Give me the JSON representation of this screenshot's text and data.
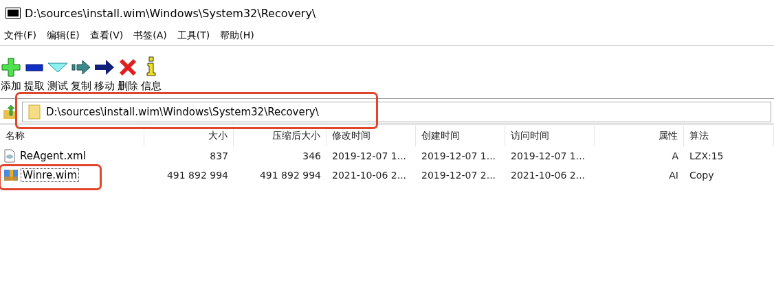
{
  "window": {
    "title": "D:\\sources\\install.wim\\Windows\\System32\\Recovery\\"
  },
  "menu": [
    "文件(F)",
    "编辑(E)",
    "查看(V)",
    "书签(A)",
    "工具(T)",
    "帮助(H)"
  ],
  "toolbar": [
    {
      "kind": "add",
      "label": "添加"
    },
    {
      "kind": "extract",
      "label": "提取"
    },
    {
      "kind": "test",
      "label": "测试"
    },
    {
      "kind": "copy",
      "label": "复制"
    },
    {
      "kind": "move",
      "label": "移动"
    },
    {
      "kind": "delete",
      "label": "删除"
    },
    {
      "kind": "info",
      "label": "信息"
    }
  ],
  "address_bar": {
    "value": "D:\\sources\\install.wim\\Windows\\System32\\Recovery\\",
    "highlighted": true
  },
  "table": {
    "columns": [
      "名称",
      "大小",
      "压缩后大小",
      "修改时间",
      "创建时间",
      "访问时间",
      "属性",
      "算法"
    ],
    "rows": [
      {
        "kind": "xml",
        "selected": false,
        "highlighted": false,
        "cells": [
          "ReAgent.xml",
          "837",
          "346",
          "2019-12-07 1...",
          "2019-12-07 1...",
          "2019-12-07 1...",
          "A",
          "LZX:15"
        ]
      },
      {
        "kind": "archive",
        "selected": true,
        "highlighted": true,
        "cells": [
          "Winre.wim",
          "491 892 994",
          "491 892 994",
          "2021-10-06 2...",
          "2019-12-07 2...",
          "2021-10-06 2...",
          "AI",
          "Copy"
        ]
      }
    ]
  }
}
